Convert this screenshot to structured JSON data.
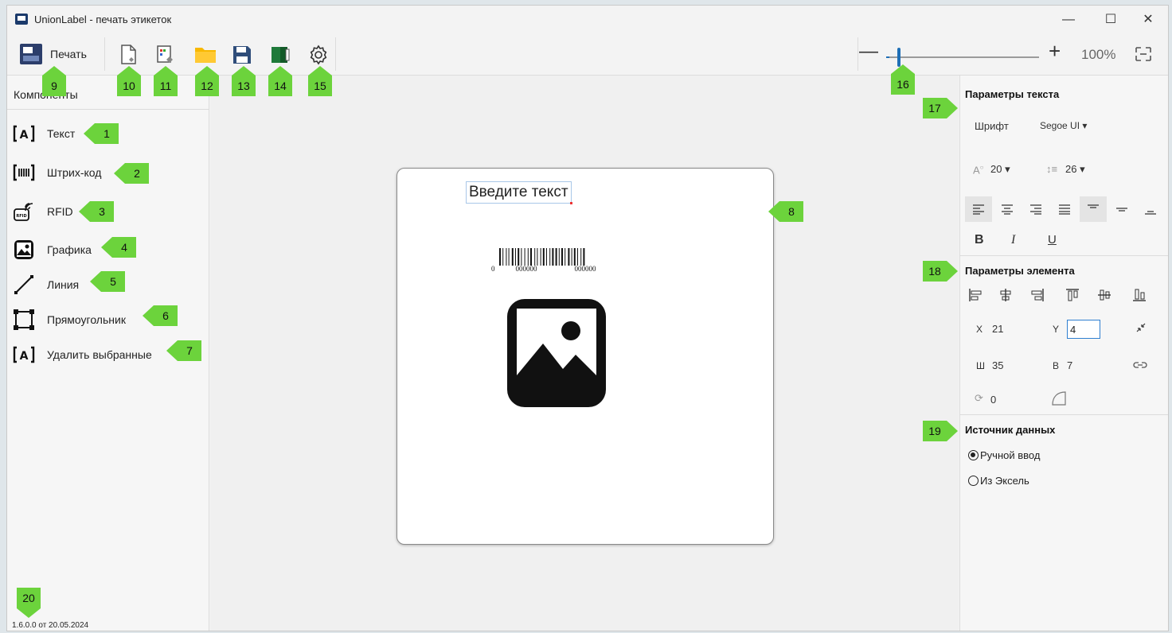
{
  "window": {
    "title": "UnionLabel - печать этикеток",
    "minimize": "—",
    "maximize": "☐",
    "close": "✕"
  },
  "toolbar": {
    "print_label": "Печать",
    "icons": [
      "new-label-icon",
      "template-icon",
      "folder-icon",
      "save-icon",
      "book-icon",
      "settings-icon"
    ],
    "zoom_minus": "—",
    "zoom_plus": "+",
    "zoom_value": "100%",
    "zoom_level_percent": 100
  },
  "components": {
    "title": "Компоненты",
    "items": [
      {
        "icon": "text-icon",
        "glyph": "[A]",
        "label": "Текст"
      },
      {
        "icon": "barcode-icon",
        "glyph": "[III]",
        "label": "Штрих-код"
      },
      {
        "icon": "rfid-icon",
        "glyph": "RFID",
        "label": "RFID"
      },
      {
        "icon": "image-icon",
        "glyph": "",
        "label": "Графика"
      },
      {
        "icon": "line-icon",
        "glyph": "",
        "label": "Линия"
      },
      {
        "icon": "rectangle-icon",
        "glyph": "",
        "label": "Прямоугольник"
      },
      {
        "icon": "delete-selected-icon",
        "glyph": "[A]",
        "label": "Удалить выбранные"
      }
    ],
    "version": "1.6.0.0 от 20.05.2024"
  },
  "canvas": {
    "text_element": "Введите текст",
    "barcode_left": "0",
    "barcode_digits_1": "000000",
    "barcode_digits_2": "000000"
  },
  "text_params": {
    "title": "Параметры текста",
    "font_label": "Шрифт",
    "font_value": "Segoe UI",
    "font_size": "20",
    "line_height": "26",
    "bold": "B",
    "italic": "I",
    "underline": "U"
  },
  "element_params": {
    "title": "Параметры элемента",
    "x_label": "X",
    "x_value": "21",
    "y_label": "Y",
    "y_value": "4",
    "w_label": "Ш",
    "w_value": "35",
    "h_label": "В",
    "h_value": "7",
    "rotation_value": "0"
  },
  "data_source": {
    "title": "Источник данных",
    "manual": "Ручной ввод",
    "excel": "Из Эксель",
    "selected": "manual"
  },
  "callouts": [
    "1",
    "2",
    "3",
    "4",
    "5",
    "6",
    "7",
    "8",
    "9",
    "10",
    "11",
    "12",
    "13",
    "14",
    "15",
    "16",
    "17",
    "18",
    "19",
    "20"
  ],
  "colors": {
    "callout": "#6cd33c",
    "accent": "#1f6fb6"
  }
}
